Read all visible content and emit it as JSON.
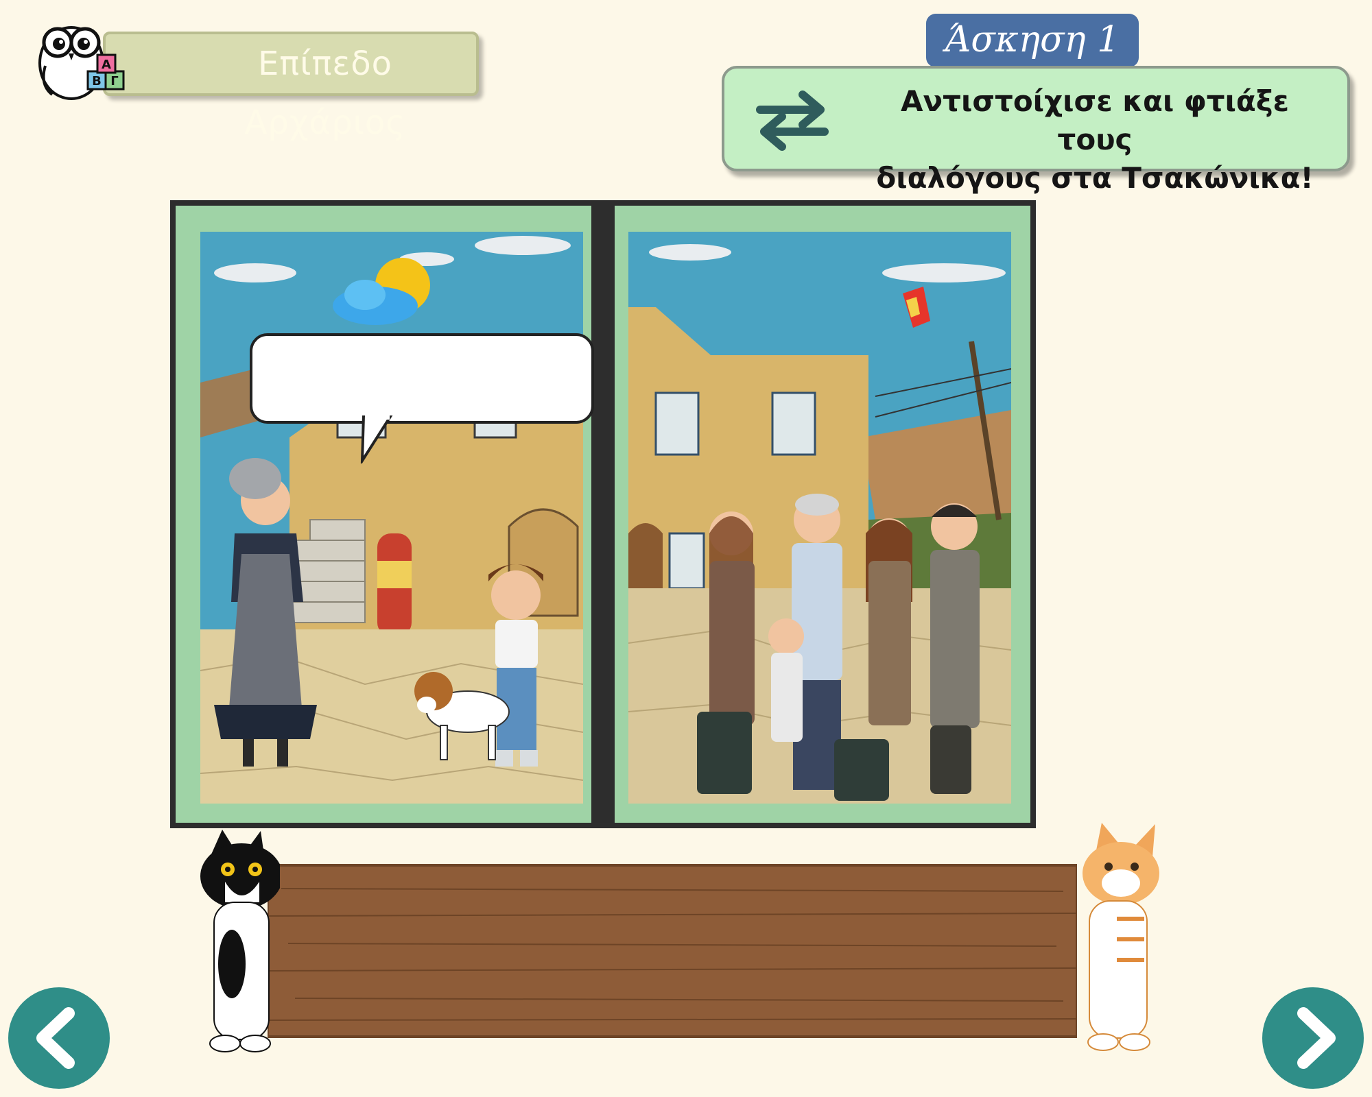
{
  "level": {
    "label": "Επίπεδο Αρχάριος",
    "owl_blocks": [
      "Α",
      "Β",
      "Γ"
    ]
  },
  "exercise": {
    "title": "Άσκηση 1",
    "instruction_line1": "Αντιστοίχισε και φτιάξε τους",
    "instruction_line2": "διαλόγους στα Τσακώνικα!",
    "icon": "swap-arrows-icon"
  },
  "panels": [
    {
      "name": "grandmother-boy-dog-scene",
      "speech_bubble_text": ""
    },
    {
      "name": "family-arrival-scene"
    }
  ],
  "navigation": {
    "prev_icon": "chevron-left-icon",
    "next_icon": "chevron-right-icon"
  },
  "colors": {
    "background": "#fdf8e8",
    "accent": "#2f8e88",
    "title_bg": "#4a6fa3",
    "instruction_bg": "#c4efc4",
    "panel_frame": "#9fd3a6",
    "board": "#8a5a38"
  }
}
